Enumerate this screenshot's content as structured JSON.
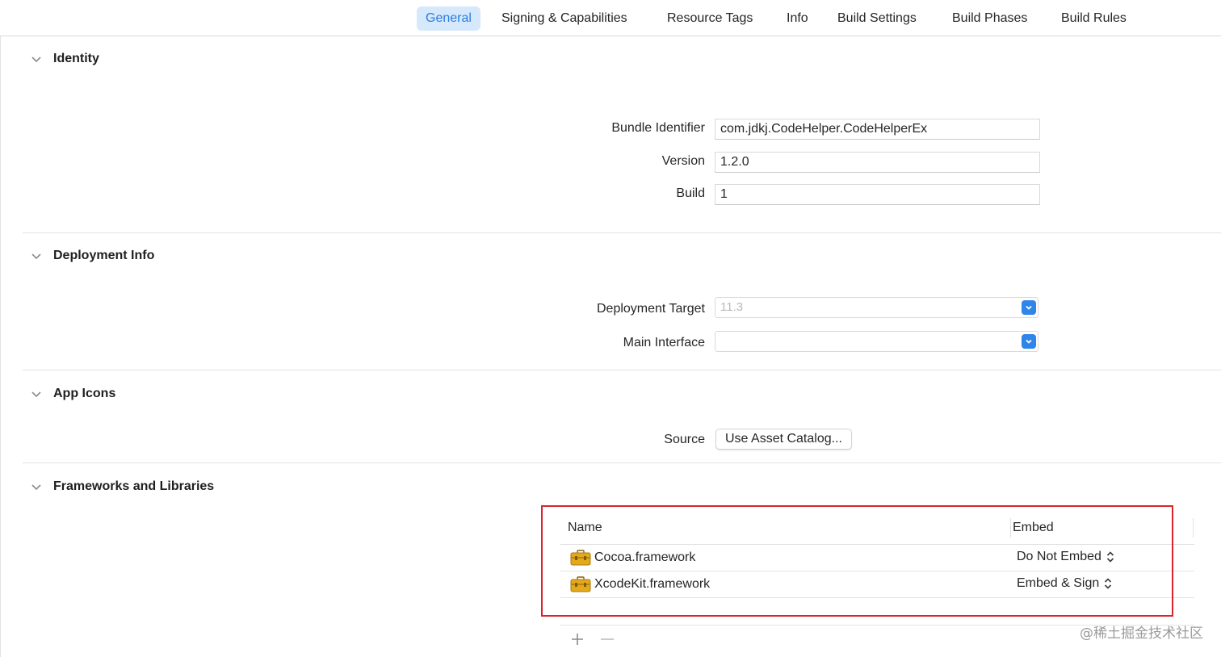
{
  "tabs": [
    {
      "label": "General",
      "active": true
    },
    {
      "label": "Signing & Capabilities"
    },
    {
      "label": "Resource Tags"
    },
    {
      "label": "Info"
    },
    {
      "label": "Build Settings"
    },
    {
      "label": "Build Phases"
    },
    {
      "label": "Build Rules"
    }
  ],
  "identity": {
    "title": "Identity",
    "bundle_identifier_label": "Bundle Identifier",
    "bundle_identifier_value": "com.jdkj.CodeHelper.CodeHelperEx",
    "version_label": "Version",
    "version_value": "1.2.0",
    "build_label": "Build",
    "build_value": "1"
  },
  "deployment": {
    "title": "Deployment Info",
    "target_label": "Deployment Target",
    "target_value": "11.3",
    "main_interface_label": "Main Interface",
    "main_interface_value": ""
  },
  "app_icons": {
    "title": "App Icons",
    "source_label": "Source",
    "source_button": "Use Asset Catalog..."
  },
  "frameworks": {
    "title": "Frameworks and Libraries",
    "columns": {
      "name": "Name",
      "embed": "Embed"
    },
    "rows": [
      {
        "name": "Cocoa.framework",
        "embed": "Do Not Embed"
      },
      {
        "name": "XcodeKit.framework",
        "embed": "Embed & Sign"
      }
    ],
    "add_symbol": "+",
    "remove_symbol": "—"
  },
  "watermark": "@稀土掘金技术社区",
  "colors": {
    "accent": "#2f86ea",
    "active_tab_bg": "#d6e8fb",
    "highlight_box": "#d9232d"
  },
  "icons": {
    "section_chevron": "chevron-down-icon",
    "popup_stepper": "popup-arrow-icon",
    "framework": "toolbox-icon",
    "embed_stepper": "up-down-chevron-icon"
  }
}
